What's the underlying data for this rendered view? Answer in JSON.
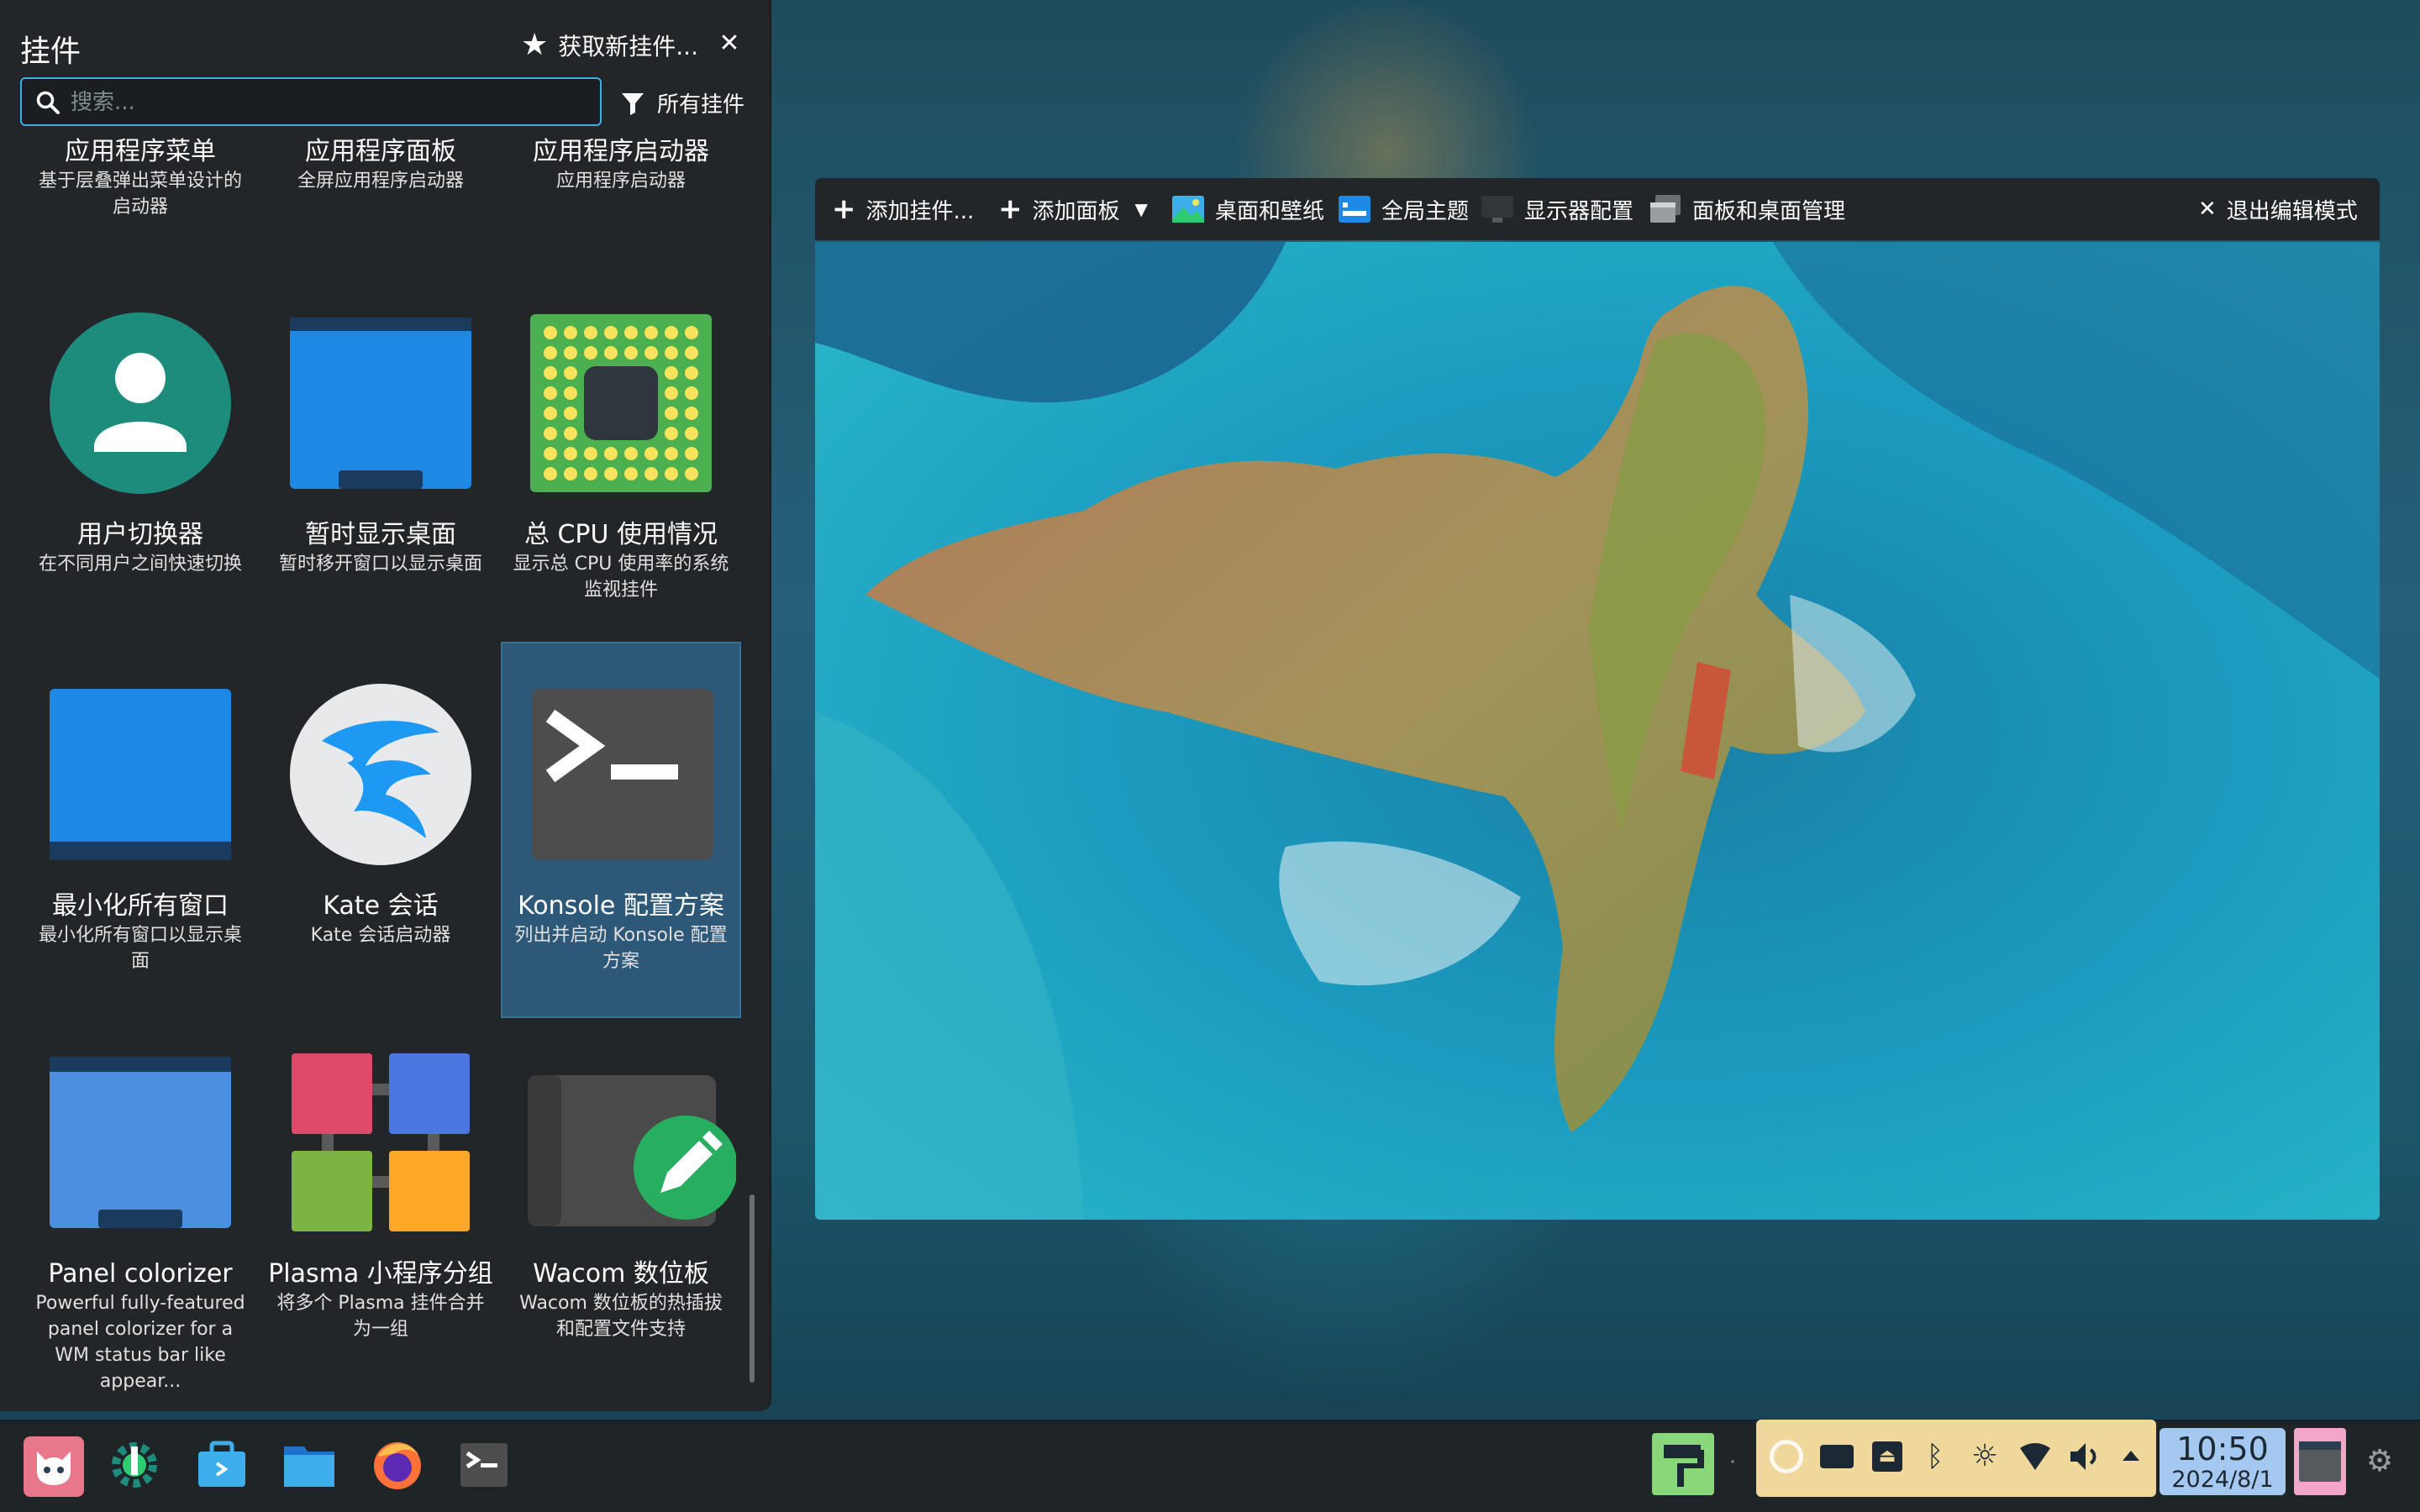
{
  "widgets_panel": {
    "title": "挂件",
    "get_new_label": "获取新挂件...",
    "search": {
      "placeholder": "搜索...",
      "value": ""
    },
    "filter_label": "所有挂件",
    "widgets": [
      {
        "name": "应用程序菜单",
        "desc": "基于层叠弹出菜单设计的启动器",
        "icon": "application-menu-icon"
      },
      {
        "name": "应用程序面板",
        "desc": "全屏应用程序启动器",
        "icon": "application-dashboard-icon"
      },
      {
        "name": "应用程序启动器",
        "desc": "应用程序启动器",
        "icon": "application-launcher-icon"
      },
      {
        "name": "用户切换器",
        "desc": "在不同用户之间快速切换",
        "icon": "user-switcher-icon"
      },
      {
        "name": "暂时显示桌面",
        "desc": "暂时移开窗口以显示桌面",
        "icon": "peek-at-desktop-icon"
      },
      {
        "name": "总 CPU 使用情况",
        "desc": "显示总 CPU 使用率的系统监视挂件",
        "icon": "cpu-chip-icon"
      },
      {
        "name": "最小化所有窗口",
        "desc": "最小化所有窗口以显示桌面",
        "icon": "minimize-all-icon"
      },
      {
        "name": "Kate 会话",
        "desc": "Kate 会话启动器",
        "icon": "kate-icon"
      },
      {
        "name": "Konsole 配置方案",
        "desc": "列出并启动 Konsole 配置方案",
        "icon": "konsole-terminal-icon",
        "selected": true
      },
      {
        "name": "Panel colorizer",
        "desc": "Powerful fully-featured panel colorizer for a WM status bar like appear...",
        "icon": "panel-colorizer-icon"
      },
      {
        "name": "Plasma 小程序分组",
        "desc": "将多个 Plasma 挂件合并为一组",
        "icon": "applet-grouping-icon"
      },
      {
        "name": "Wacom 数位板",
        "desc": "Wacom 数位板的热插拔和配置文件支持",
        "icon": "wacom-tablet-icon"
      }
    ]
  },
  "edit_toolbar": {
    "add_widgets": "添加挂件...",
    "add_panel": "添加面板",
    "wallpaper": "桌面和壁纸",
    "global_theme": "全局主题",
    "display_config": "显示器配置",
    "panel_desktop_mgmt": "面板和桌面管理",
    "exit_edit": "退出编辑模式"
  },
  "taskbar": {
    "apps": [
      "kickoff-launcher-icon",
      "system-settings-icon",
      "discover-store-icon",
      "dolphin-files-icon",
      "firefox-icon",
      "konsole-icon"
    ],
    "clock_time": "10:50",
    "clock_date": "2024/8/1"
  },
  "colors": {
    "accent": "#3daee9",
    "panel_bg": "#232629",
    "tray_bg": "#f0d79b",
    "clock_bg": "#a5c8f0",
    "selection_bg": "#2d5878"
  }
}
